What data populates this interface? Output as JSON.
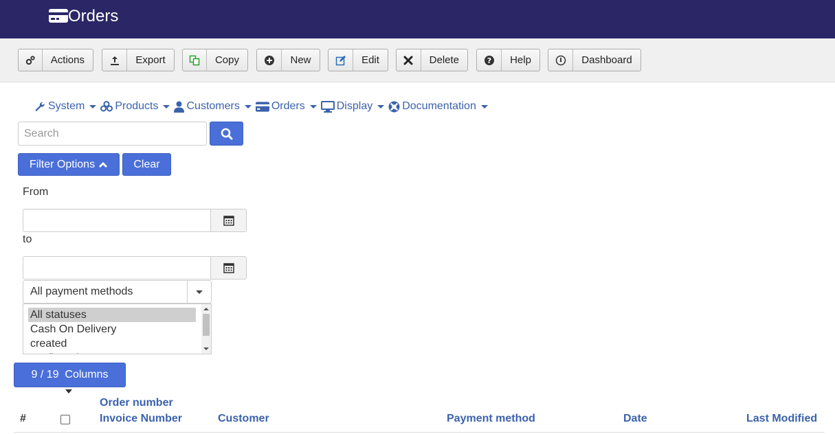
{
  "title": "Orders",
  "toolbar": {
    "buttons": [
      {
        "label": "Actions",
        "icon": "gears-icon"
      },
      {
        "label": "Export",
        "icon": "upload-icon"
      },
      {
        "label": "Copy",
        "icon": "copy-icon"
      },
      {
        "label": "New",
        "icon": "plus-circle-icon"
      },
      {
        "label": "Edit",
        "icon": "edit-icon"
      },
      {
        "label": "Delete",
        "icon": "close-icon"
      },
      {
        "label": "Help",
        "icon": "question-circle-icon"
      },
      {
        "label": "Dashboard",
        "icon": "dashboard-icon"
      }
    ]
  },
  "nav": {
    "items": [
      {
        "label": "System",
        "icon": "wrench-icon"
      },
      {
        "label": "Products",
        "icon": "cubes-icon"
      },
      {
        "label": "Customers",
        "icon": "user-icon"
      },
      {
        "label": "Orders",
        "icon": "credit-card-icon"
      },
      {
        "label": "Display",
        "icon": "monitor-icon"
      },
      {
        "label": "Documentation",
        "icon": "life-ring-icon"
      }
    ]
  },
  "search": {
    "placeholder": "Search",
    "value": ""
  },
  "filters": {
    "options_label": "Filter Options",
    "clear_label": "Clear",
    "from_label": "From",
    "to_label": "to",
    "from_value": "",
    "to_value": "",
    "payment_select": "All payment methods",
    "status_options": [
      "All statuses",
      "Cash On Delivery",
      "created",
      "confirmed"
    ],
    "selected_status": "All statuses"
  },
  "columns_button": "9 / 19  Columns",
  "table": {
    "headers": {
      "hash": "#",
      "order_number": "Order number",
      "invoice_number": "Invoice Number",
      "customer": "Customer",
      "payment_method": "Payment method",
      "date": "Date",
      "last_modified": "Last Modified"
    }
  },
  "colors": {
    "titlebar": "#2b2766",
    "primary_button": "#4a6fd8",
    "link": "#3b62ad",
    "toolbar_bg": "#f0f0f0"
  }
}
